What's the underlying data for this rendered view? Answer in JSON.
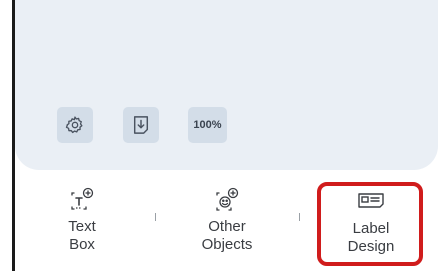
{
  "canvas_toolbar": {
    "settings_icon": "gear-icon",
    "download_icon": "download-icon",
    "zoom_label": "100%"
  },
  "bottom_tabs": [
    {
      "line1": "Text",
      "line2": "Box",
      "icon": "text-box-add-icon"
    },
    {
      "line1": "Other",
      "line2": "Objects",
      "icon": "smiley-add-icon"
    },
    {
      "line1": "Label",
      "line2": "Design",
      "icon": "label-design-icon",
      "highlighted": true
    }
  ],
  "colors": {
    "panel_background": "#eaeff5",
    "button_background": "#d3dde8",
    "highlight_border": "#d01c1c",
    "text": "#3a3d42"
  }
}
